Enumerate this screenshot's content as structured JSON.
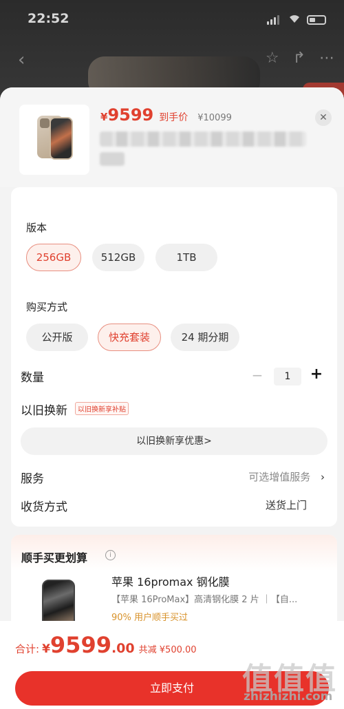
{
  "status_bar": {
    "time": "22:52"
  },
  "product": {
    "price_currency": "¥",
    "price": "9599",
    "price_tag": "到手价",
    "original_price": "¥10099",
    "close_icon": "close-icon"
  },
  "options": {
    "version_label": "版本",
    "versions": [
      "256GB",
      "512GB",
      "1TB"
    ],
    "version_selected": "256GB",
    "purchase_label": "购买方式",
    "purchase_methods": [
      "公开版",
      "快充套装",
      "24 期分期"
    ],
    "purchase_selected": "快充套装"
  },
  "quantity": {
    "label": "数量",
    "minus": "−",
    "value": "1",
    "plus": "+"
  },
  "trade_in": {
    "label": "以旧换新",
    "badge": "以旧换新享补贴",
    "button": "以旧换新享优惠>"
  },
  "service": {
    "label": "服务",
    "value": "可选增值服务",
    "chevron": "›"
  },
  "delivery": {
    "label": "收货方式",
    "value": "送货上门"
  },
  "bundle": {
    "title": "顺手买更划算",
    "info_icon": "i",
    "item_name": "苹果 16promax 钢化膜",
    "item_desc": "【苹果 16ProMax】高清钢化膜 2 片 ｜【自...",
    "item_social": "90% 用户顺手买过"
  },
  "footer": {
    "total_label": "合计:",
    "currency": "¥",
    "total_int": "9599",
    "total_dec": ".00",
    "saving": "共减 ¥500.00",
    "pay_button": "立即支付"
  },
  "watermark": {
    "logo": "值值值",
    "url": "zhizhizhi.com"
  },
  "colors": {
    "accent": "#e0412f",
    "pay_button": "#e8322a",
    "social": "#d8922a"
  }
}
